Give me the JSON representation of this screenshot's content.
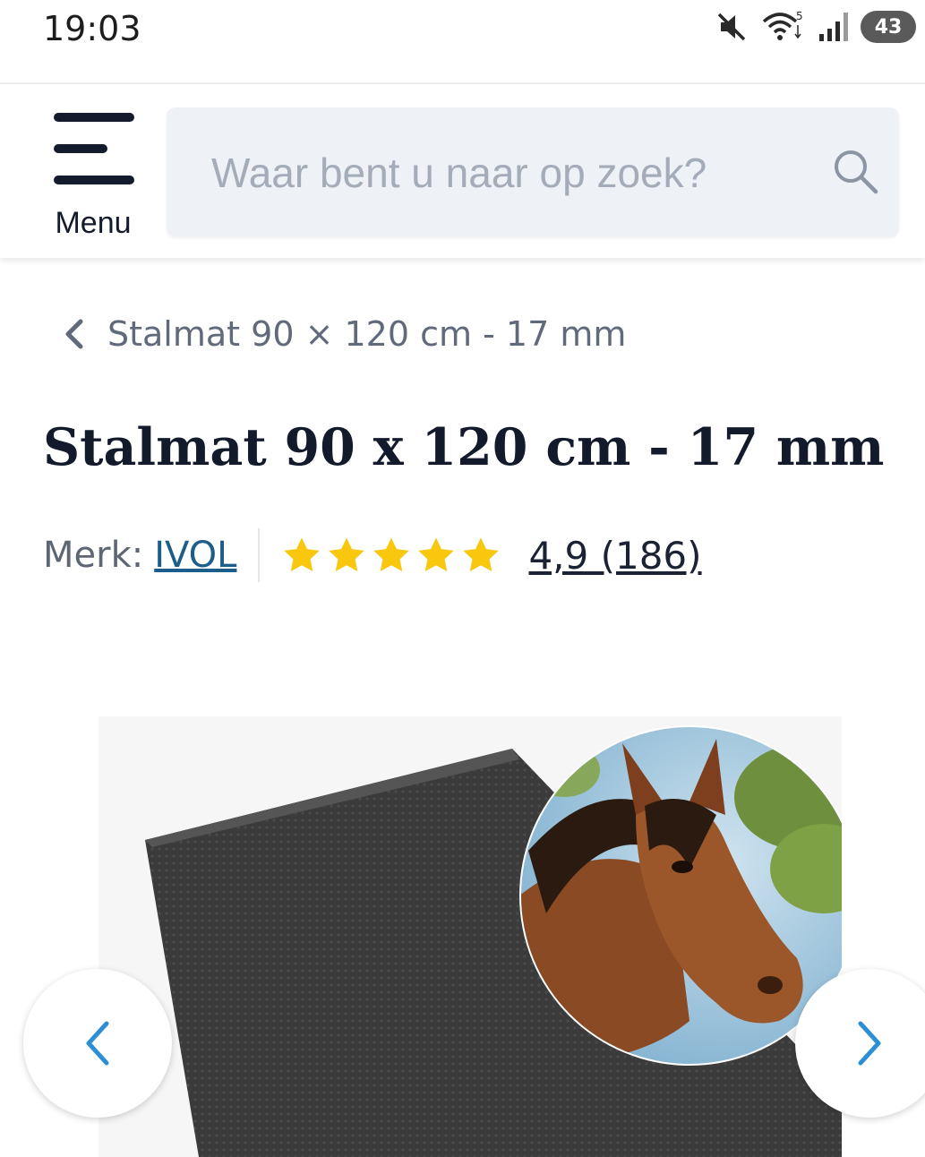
{
  "status_bar": {
    "time": "19:03",
    "battery": "43",
    "icons": [
      "mute-icon",
      "wifi-icon",
      "signal-icon",
      "battery-icon"
    ]
  },
  "header": {
    "menu_label": "Menu",
    "search_placeholder": "Waar bent u naar op zoek?"
  },
  "breadcrumb": {
    "label": "Stalmat 90 × 120 cm - 17 mm"
  },
  "product": {
    "title": "Stalmat 90 x 120 cm - 17 mm",
    "brand_label": "Merk:",
    "brand_name": "IVOL",
    "rating_value": 4.9,
    "rating_max": 5,
    "rating_text": "4,9 (186)",
    "star_color": "#f9c80e"
  },
  "gallery": {
    "image_description_icon": "horse-mat-image",
    "prev_icon": "chevron-left-icon",
    "next_icon": "chevron-right-icon",
    "accent_color": "#2a8fd4"
  }
}
